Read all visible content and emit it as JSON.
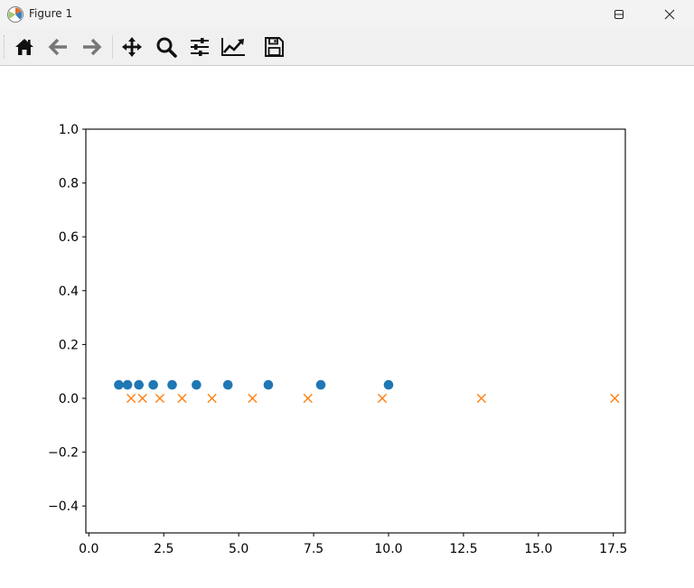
{
  "window": {
    "title": "Figure 1",
    "app_icon": "matplotlib-icon",
    "controls": {
      "minimize_icon": "minimize-icon",
      "maximize_icon": "maximize-icon",
      "close_icon": "close-icon"
    }
  },
  "toolbar": {
    "tools": [
      {
        "name": "home",
        "icon": "home-icon"
      },
      {
        "name": "back",
        "icon": "arrow-left-icon"
      },
      {
        "name": "forward",
        "icon": "arrow-right-icon"
      },
      {
        "name": "pan",
        "icon": "move-icon"
      },
      {
        "name": "zoom",
        "icon": "magnifier-icon"
      },
      {
        "name": "subplots",
        "icon": "sliders-icon"
      },
      {
        "name": "customize",
        "icon": "chart-line-icon"
      },
      {
        "name": "save",
        "icon": "floppy-disk-icon"
      }
    ]
  },
  "chart_data": {
    "type": "scatter",
    "title": "",
    "xlabel": "",
    "ylabel": "",
    "xlim": [
      -0.1,
      17.9
    ],
    "ylim": [
      -0.5,
      1.0
    ],
    "x_ticks": [
      "0.0",
      "2.5",
      "5.0",
      "7.5",
      "10.0",
      "12.5",
      "15.0",
      "17.5"
    ],
    "x_tick_values": [
      0,
      2.5,
      5,
      7.5,
      10,
      12.5,
      15,
      17.5
    ],
    "y_ticks": [
      "−0.4",
      "−0.2",
      "0.0",
      "0.2",
      "0.4",
      "0.6",
      "0.8",
      "1.0"
    ],
    "y_tick_values": [
      -0.4,
      -0.2,
      0,
      0.2,
      0.4,
      0.6,
      0.8,
      1.0
    ],
    "grid": false,
    "series": [
      {
        "marker": "circle",
        "color": "#1f77b4",
        "x": [
          1.0,
          1.29,
          1.67,
          2.15,
          2.78,
          3.59,
          4.64,
          5.99,
          7.74,
          10.0
        ],
        "y": [
          0.05,
          0.05,
          0.05,
          0.05,
          0.05,
          0.05,
          0.05,
          0.05,
          0.05,
          0.05
        ]
      },
      {
        "marker": "x",
        "color": "#ff7f0e",
        "x": [
          1.41,
          1.79,
          2.37,
          3.11,
          4.11,
          5.46,
          7.31,
          9.79,
          13.1,
          17.55
        ],
        "y": [
          0,
          0,
          0,
          0,
          0,
          0,
          0,
          0,
          0,
          0
        ]
      }
    ]
  }
}
